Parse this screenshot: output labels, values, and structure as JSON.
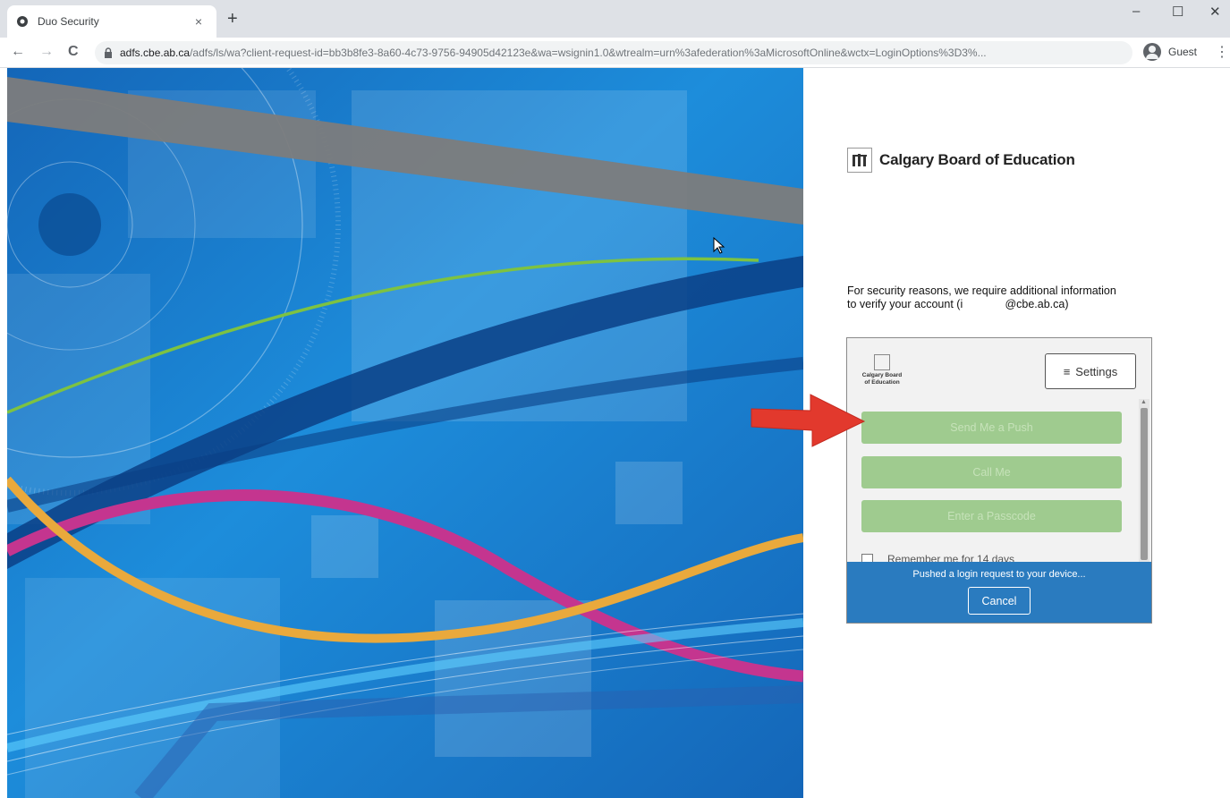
{
  "browser": {
    "tab_title": "Duo Security",
    "tab_close": "×",
    "new_tab": "+",
    "url_host": "adfs.cbe.ab.ca",
    "url_rest": "/adfs/ls/wa?client-request-id=bb3b8fe3-8a60-4c73-9756-94905d42123e&wa=wsignin1.0&wtrealm=urn%3afederation%3aMicrosoftOnline&wctx=LoginOptions%3D3%...",
    "profile_label": "Guest",
    "controls": {
      "minimize": "–",
      "maximize": "☐",
      "close": "✕"
    },
    "nav": {
      "back": "←",
      "forward": "→",
      "reload": "C",
      "menu": "⋮"
    }
  },
  "org": {
    "name": "Calgary Board of Education"
  },
  "security_message": {
    "line1": "For security reasons, we require additional information",
    "line2_prefix": "to verify your account (",
    "line2_mask": "i",
    "line2_suffix": "@cbe.ab.ca)"
  },
  "duo": {
    "logo_text": "Calgary Board of Education",
    "settings_icon": "≡",
    "settings_label": "Settings",
    "buttons": [
      "Send Me a Push",
      "Call Me",
      "Enter a Passcode"
    ],
    "remember_label": "Remember me for 14 days",
    "status_text": "Pushed a login request to your device...",
    "cancel_label": "Cancel"
  },
  "colors": {
    "accent_blue": "#2a7bbf",
    "auth_button_green": "#9fcb8f",
    "arrow_red": "#e2392d",
    "hero_blue": "#1a78c8"
  },
  "icons": [
    "duo-favicon",
    "lock-icon",
    "profile-icon",
    "org-logo-icon",
    "hamburger-icon",
    "red-arrow-annotation",
    "mouse-cursor-icon"
  ]
}
